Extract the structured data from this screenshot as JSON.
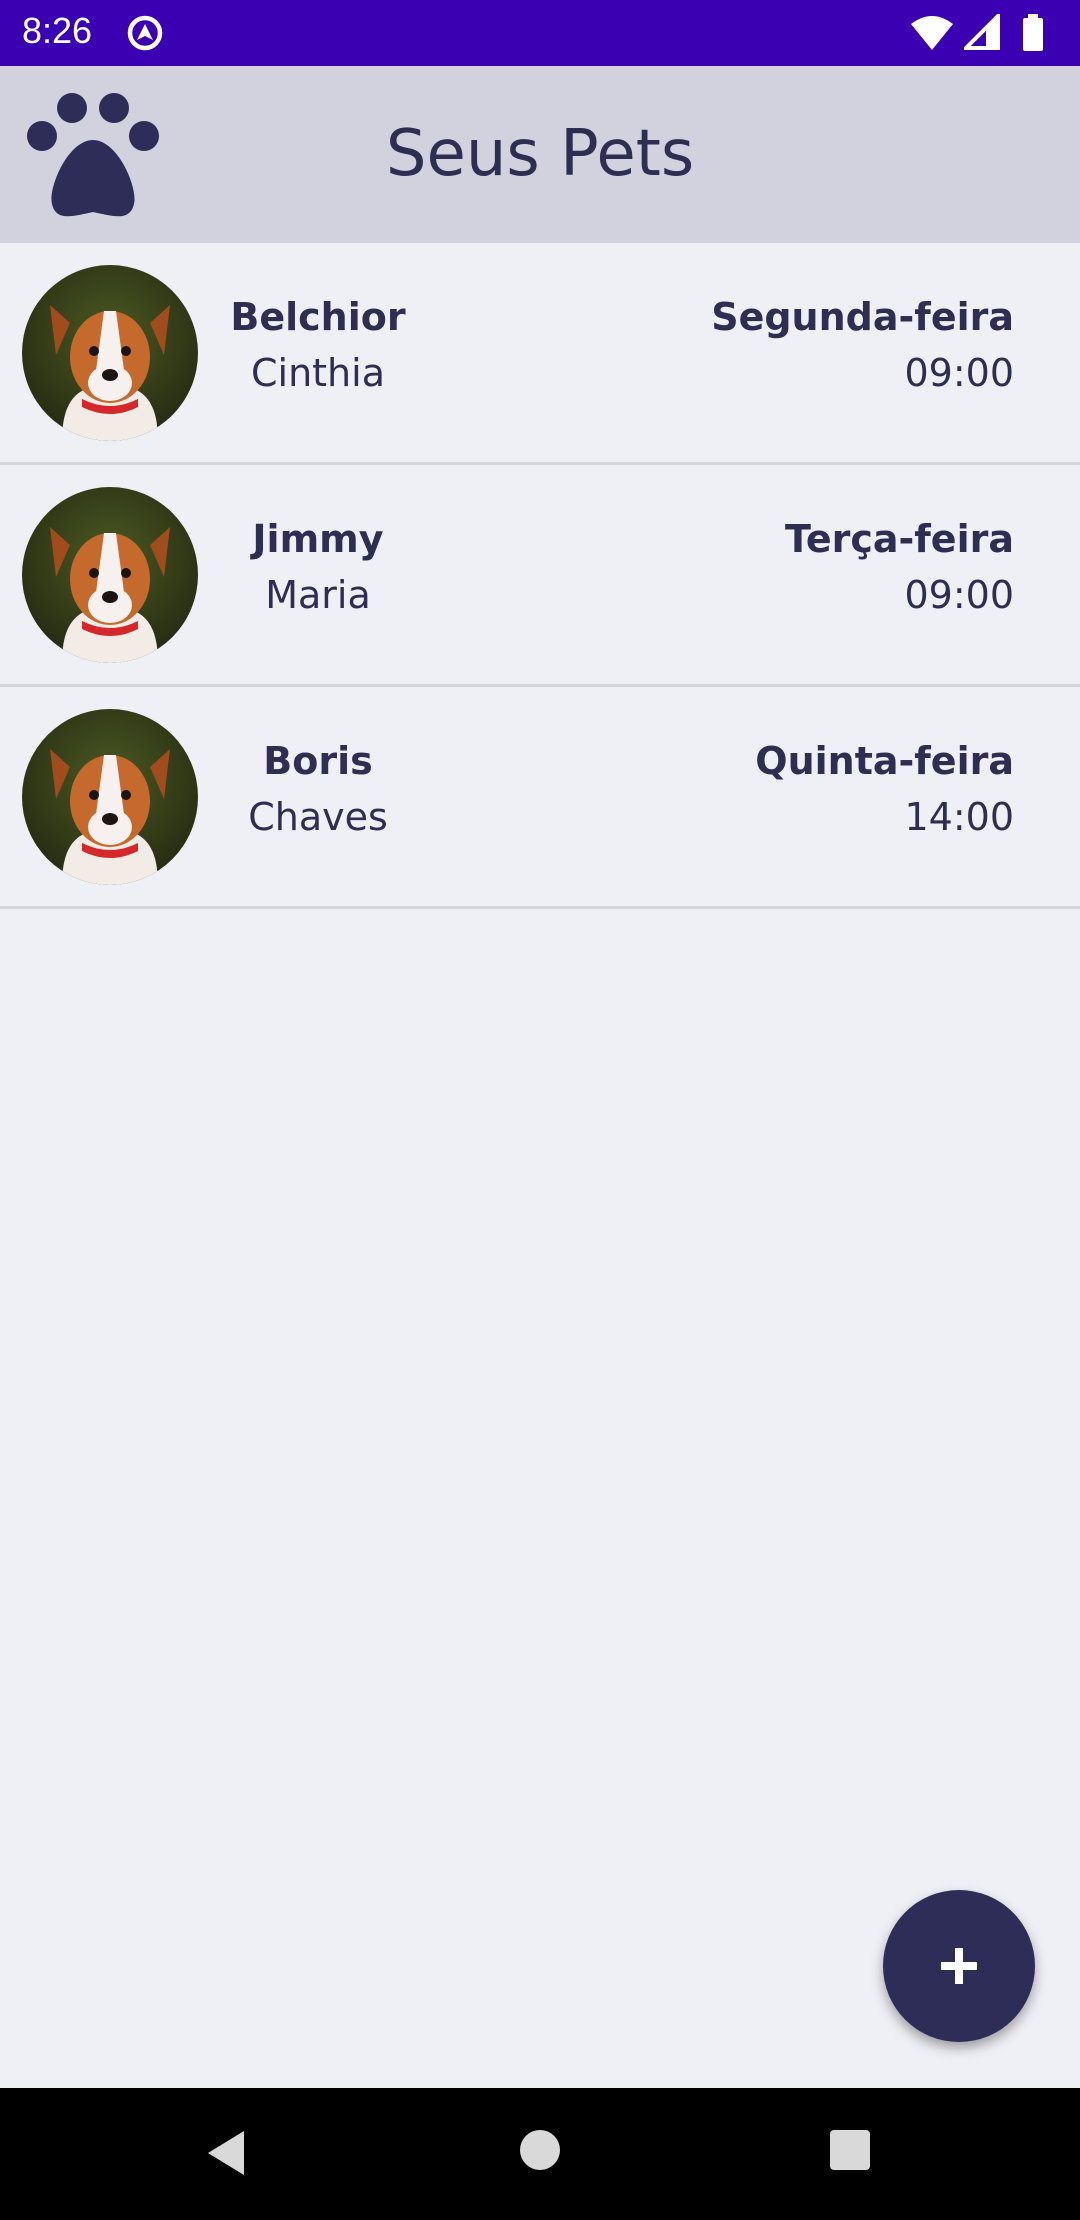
{
  "status_bar": {
    "time": "8:26",
    "background": "#3c00b3",
    "icons": [
      "app-notification-icon",
      "wifi-icon",
      "cell-signal-icon",
      "battery-icon"
    ]
  },
  "app_bar": {
    "title": "Seus Pets",
    "logo_icon": "paw-icon",
    "background": "#d2d2de"
  },
  "pets": [
    {
      "name": "Belchior",
      "owner": "Cinthia",
      "day": "Segunda-feira",
      "time": "09:00"
    },
    {
      "name": "Jimmy",
      "owner": "Maria",
      "day": "Terça-feira",
      "time": "09:00"
    },
    {
      "name": "Boris",
      "owner": "Chaves",
      "day": "Quinta-feira",
      "time": "14:00"
    }
  ],
  "fab": {
    "icon": "plus-icon",
    "color": "#2e2d57"
  },
  "nav_bar": {
    "buttons": [
      "back-icon",
      "home-icon",
      "recents-icon"
    ]
  },
  "colors": {
    "accent": "#2e2d52",
    "background": "#efeff6"
  }
}
